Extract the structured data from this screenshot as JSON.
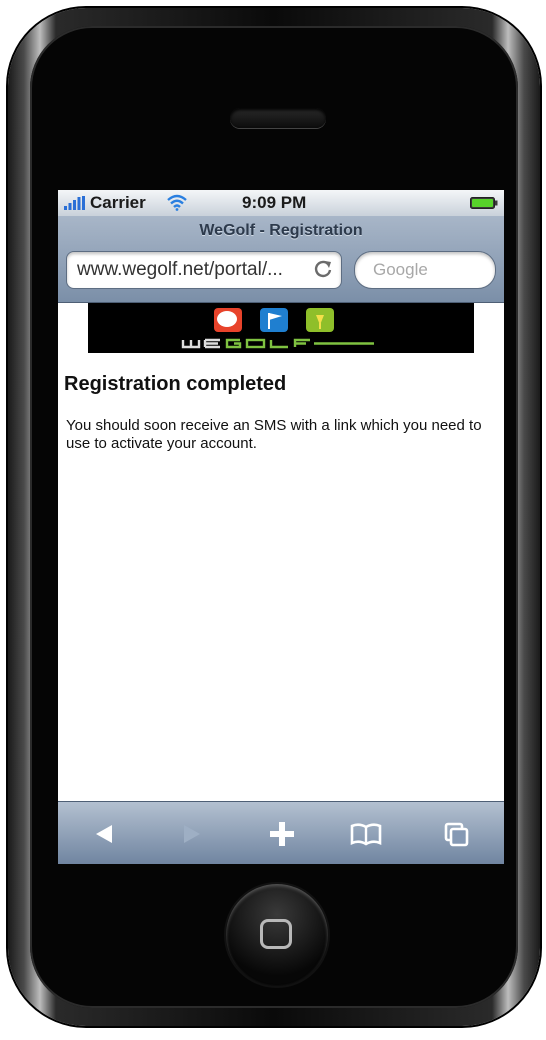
{
  "status_bar": {
    "carrier": "Carrier",
    "time": "9:09 PM"
  },
  "browser": {
    "page_title": "WeGolf - Registration",
    "url": "www.wegolf.net/portal/...",
    "search_placeholder": "Google"
  },
  "page": {
    "logo_text": "wegolf",
    "heading": "Registration completed",
    "message": "You should soon receive an SMS with a link which you need to use to activate your account."
  },
  "toolbar": {
    "icons": [
      "back-icon",
      "forward-icon",
      "add-icon",
      "bookmarks-icon",
      "pages-icon"
    ]
  },
  "colors": {
    "navbar_top": "#a8b6c8",
    "navbar_bottom": "#7b8fa8",
    "logo_red": "#e8432b",
    "logo_blue": "#1f7fd0",
    "logo_green": "#8fbf2a"
  }
}
